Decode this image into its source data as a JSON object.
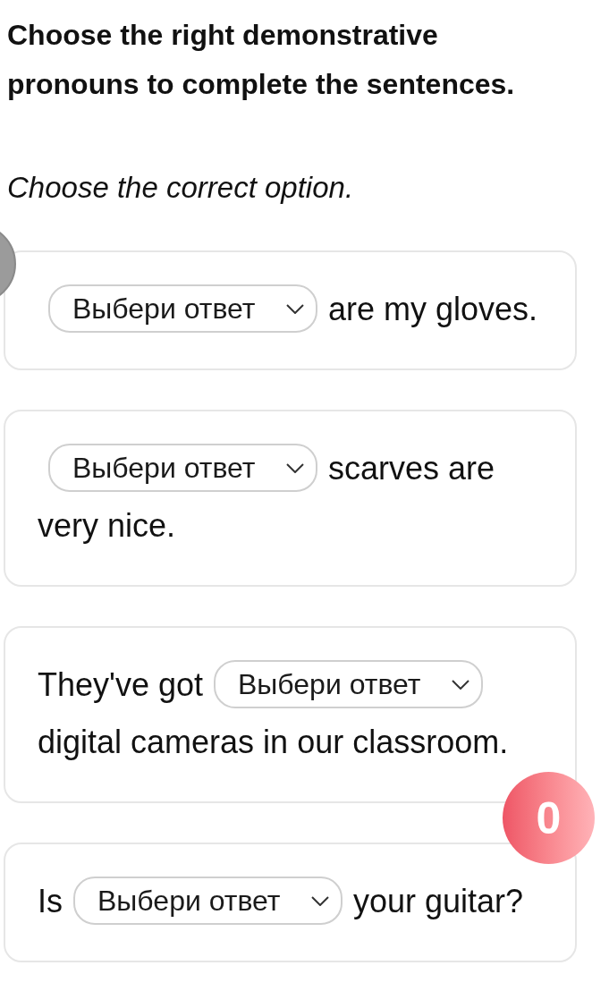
{
  "heading": "Choose the right demonstrative pronouns to complete the sentences.",
  "instruction": "Choose the correct option.",
  "questions": [
    {
      "parts": [
        {
          "kind": "select",
          "placeholder": "Выбери ответ"
        },
        {
          "kind": "text",
          "text": "are my gloves."
        }
      ]
    },
    {
      "parts": [
        {
          "kind": "select",
          "placeholder": "Выбери ответ"
        },
        {
          "kind": "text",
          "text": "scarves are"
        },
        {
          "kind": "text",
          "text": "very nice."
        }
      ]
    },
    {
      "parts": [
        {
          "kind": "text",
          "text": "They've got"
        },
        {
          "kind": "select",
          "placeholder": "Выбери ответ"
        },
        {
          "kind": "text",
          "text": "digital cameras in our classroom."
        }
      ]
    },
    {
      "parts": [
        {
          "kind": "text",
          "text": "Is"
        },
        {
          "kind": "select",
          "placeholder": "Выбери ответ"
        },
        {
          "kind": "text",
          "text": "your guitar?"
        }
      ]
    }
  ],
  "score_badge": {
    "text": "0"
  }
}
